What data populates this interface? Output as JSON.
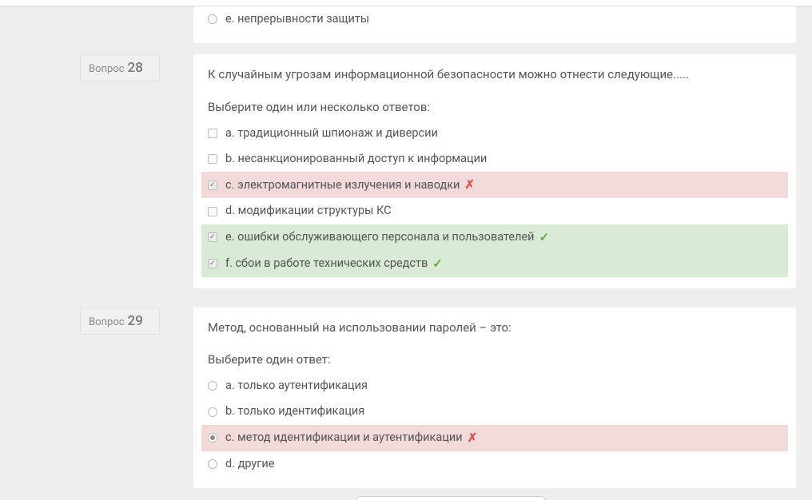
{
  "partial_question": {
    "options": [
      {
        "label": "e. непрерывности защиты",
        "type": "radio",
        "checked": false,
        "status": "none"
      }
    ]
  },
  "questions": [
    {
      "label_prefix": "Вопрос",
      "number": "28",
      "text": "К случайным угрозам информационной безопасности можно отнести следующие.....",
      "instruction": "Выберите один или несколько ответов:",
      "input_type": "checkbox",
      "options": [
        {
          "label": "a. традиционный шпионаж и диверсии",
          "checked": false,
          "status": "none"
        },
        {
          "label": "b. несанкционированный доступ к информации",
          "checked": false,
          "status": "none"
        },
        {
          "label": "c. электромагнитные излучения и наводки",
          "checked": true,
          "status": "incorrect"
        },
        {
          "label": "d. модификации структуры КС",
          "checked": false,
          "status": "none"
        },
        {
          "label": "e. ошибки обслуживающего персонала и пользователей",
          "checked": true,
          "status": "correct"
        },
        {
          "label": "f. сбои в работе технических средств",
          "checked": true,
          "status": "correct"
        }
      ]
    },
    {
      "label_prefix": "Вопрос",
      "number": "29",
      "text": "Метод, основанный на использовании паролей – это:",
      "instruction": "Выберите один ответ:",
      "input_type": "radio",
      "options": [
        {
          "label": "a. только аутентификация",
          "checked": false,
          "status": "none"
        },
        {
          "label": "b. только идентификация",
          "checked": false,
          "status": "none"
        },
        {
          "label": "c. метод идентификации и аутентификации",
          "checked": true,
          "status": "incorrect"
        },
        {
          "label": "d. другие",
          "checked": false,
          "status": "none"
        }
      ]
    }
  ]
}
